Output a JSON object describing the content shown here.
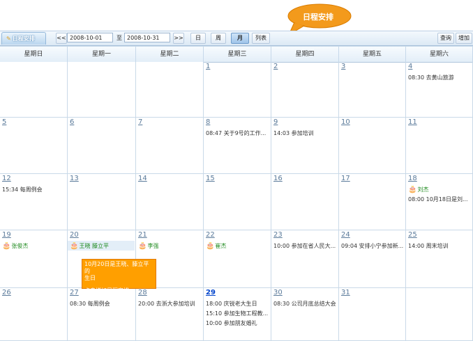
{
  "bubble": {
    "text": "日程安排"
  },
  "toolbar": {
    "title": "日程安排",
    "prev": "<<",
    "start_date": "2008-10-01",
    "to": "至",
    "end_date": "2008-10-31",
    "next": ">>",
    "view_day": "日",
    "view_week": "周",
    "view_month": "月",
    "view_list": "列表",
    "query": "查询",
    "add": "增加"
  },
  "weekdays": [
    "星期日",
    "星期一",
    "星期二",
    "星期三",
    "星期四",
    "星期五",
    "星期六"
  ],
  "weeks": [
    [
      {
        "day": ""
      },
      {
        "day": ""
      },
      {
        "day": ""
      },
      {
        "day": "1"
      },
      {
        "day": "2"
      },
      {
        "day": "3"
      },
      {
        "day": "4",
        "events": [
          "08:30 去黄山旅游"
        ]
      }
    ],
    [
      {
        "day": "5"
      },
      {
        "day": "6"
      },
      {
        "day": "7"
      },
      {
        "day": "8",
        "events": [
          "08:47 关于9号的工作..."
        ]
      },
      {
        "day": "9",
        "events": [
          "14:03 参加培训"
        ]
      },
      {
        "day": "10"
      },
      {
        "day": "11"
      }
    ],
    [
      {
        "day": "12",
        "events": [
          "15:34 每周例会"
        ]
      },
      {
        "day": "13"
      },
      {
        "day": "14"
      },
      {
        "day": "15"
      },
      {
        "day": "16"
      },
      {
        "day": "17"
      },
      {
        "day": "18",
        "birthdays": [
          "刘杰"
        ],
        "events": [
          "08:00 10月18日是刘..."
        ]
      }
    ],
    [
      {
        "day": "19",
        "birthdays": [
          "张俊杰"
        ]
      },
      {
        "day": "20",
        "birthdays": [
          "王晓  滕立平"
        ],
        "selected": true
      },
      {
        "day": "21",
        "birthdays": [
          "李强"
        ]
      },
      {
        "day": "22",
        "birthdays": [
          "崔杰"
        ]
      },
      {
        "day": "23",
        "events": [
          "10:00 参加在省人民大..."
        ]
      },
      {
        "day": "24",
        "events": [
          "09:04 安排小宁参加新..."
        ]
      },
      {
        "day": "25",
        "events": [
          "14:00 周末培训"
        ]
      }
    ],
    [
      {
        "day": "26"
      },
      {
        "day": "27",
        "events": [
          "08:30 每周例会"
        ]
      },
      {
        "day": "28",
        "events": [
          "20:00 去浙大参加培训"
        ]
      },
      {
        "day": "29",
        "today": true,
        "events": [
          "18:00 庆锐老大生日",
          "15:10 参加生物工程教...",
          "10:00 参加朋友婚礼"
        ]
      },
      {
        "day": "30",
        "events": [
          "08:30 公司月底总结大会"
        ]
      },
      {
        "day": "31"
      },
      {
        "day": ""
      }
    ]
  ],
  "popup": {
    "line1": "10月20日是王晓、滕立平的",
    "line2": "生日",
    "add_text": "点击增加日程安排"
  }
}
